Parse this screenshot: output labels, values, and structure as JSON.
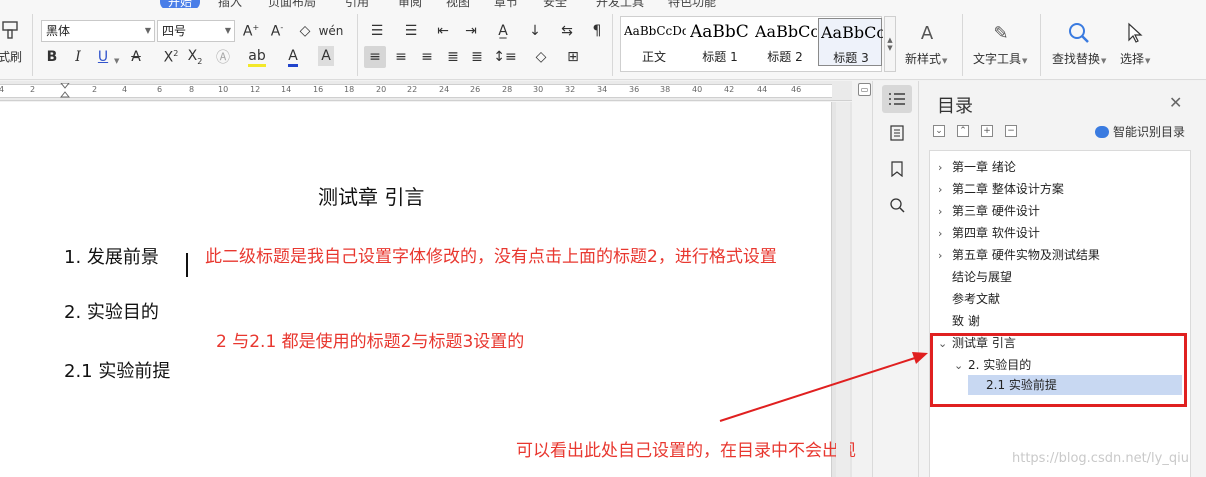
{
  "menu": {
    "items": [
      "开始",
      "插入",
      "页面布局",
      "引用",
      "审阅",
      "视图",
      "章节",
      "安全",
      "开发工具",
      "特色功能"
    ],
    "active": "开始"
  },
  "ribbon": {
    "format_painter_label": "格式刷",
    "font_name": "黑体",
    "font_size": "四号",
    "bold": "B",
    "italic": "I",
    "underline": "U",
    "styles": [
      {
        "sample": "AaBbCcDd",
        "name": "正文"
      },
      {
        "sample": "AaBbC",
        "name": "标题 1"
      },
      {
        "sample": "AaBbCc",
        "name": "标题 2"
      },
      {
        "sample": "AaBbCc",
        "name": "标题 3"
      }
    ],
    "new_style_label": "新样式",
    "text_tools_label": "文字工具",
    "find_replace_label": "查找替换",
    "select_label": "选择"
  },
  "ruler": {
    "numbers": [
      "4",
      "2",
      "2",
      "4",
      "6",
      "8",
      "10",
      "12",
      "14",
      "16",
      "18",
      "20",
      "22",
      "24",
      "26",
      "28",
      "30",
      "32",
      "34",
      "36",
      "38",
      "40",
      "42",
      "44",
      "46"
    ]
  },
  "document": {
    "chapter_title": "测试章  引言",
    "heading_1": "1.   发展前景",
    "heading_2": "2.  实验目的",
    "heading_3": "2.1  实验前提",
    "annotation_1": "此二级标题是我自己设置字体修改的，没有点击上面的标题2，进行格式设置",
    "annotation_2": "2 与2.1 都是使用的标题2与标题3设置的",
    "annotation_3": "可以看出此处自己设置的，在目录中不会出现"
  },
  "nav_pane": {
    "title": "目录",
    "smart_toc_label": "智能识别目录",
    "toc": [
      {
        "label": "第一章    绪论",
        "level": 1,
        "chevron": "right"
      },
      {
        "label": "第二章    整体设计方案",
        "level": 1,
        "chevron": "right"
      },
      {
        "label": "第三章    硬件设计",
        "level": 1,
        "chevron": "right"
      },
      {
        "label": "第四章    软件设计",
        "level": 1,
        "chevron": "right"
      },
      {
        "label": "第五章    硬件实物及测试结果",
        "level": 1,
        "chevron": "right"
      },
      {
        "label": "结论与展望",
        "level": 1,
        "chevron": "none"
      },
      {
        "label": "参考文献",
        "level": 1,
        "chevron": "none"
      },
      {
        "label": "致    谢",
        "level": 1,
        "chevron": "none"
      },
      {
        "label": "测试章  引言",
        "level": 1,
        "chevron": "down"
      },
      {
        "label": "2.  实验目的",
        "level": 2,
        "chevron": "down"
      },
      {
        "label": "2.1  实验前提",
        "level": 3,
        "chevron": "none",
        "selected": true
      }
    ]
  },
  "watermark": "https://blog.csdn.net/ly_qiu",
  "colors": {
    "annotation_red": "#e8372f",
    "highlight_box_red": "#e02020",
    "selected_toc_bg": "#c8d8f2",
    "accent_blue": "#3a7be0"
  }
}
